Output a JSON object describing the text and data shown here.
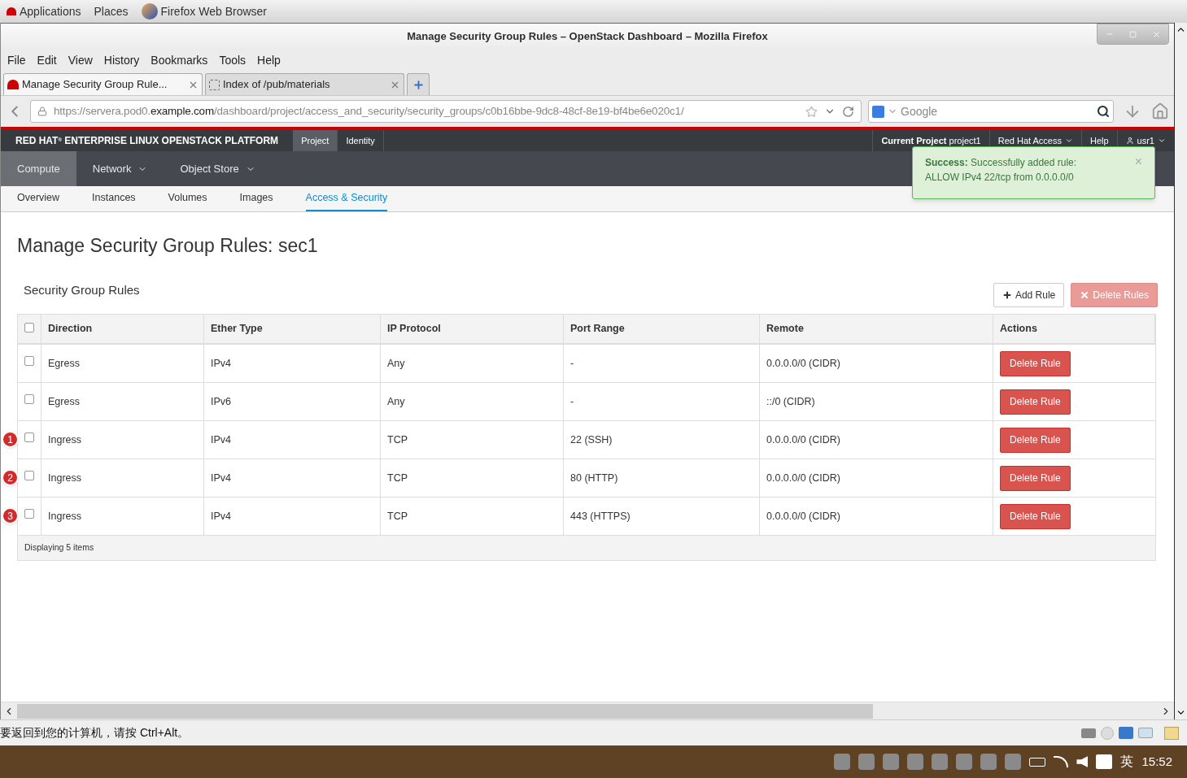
{
  "desktop_bar": {
    "items": [
      "Applications",
      "Places",
      "Firefox Web Browser"
    ]
  },
  "window": {
    "title": "Manage Security Group Rules – OpenStack Dashboard – Mozilla Firefox"
  },
  "menu": [
    "File",
    "Edit",
    "View",
    "History",
    "Bookmarks",
    "Tools",
    "Help"
  ],
  "browser_tabs": [
    {
      "label": "Manage Security Group Rule...",
      "selected": true
    },
    {
      "label": "Index of /pub/materials",
      "selected": false
    }
  ],
  "address": {
    "host_prefix": "https://servera.pod0.",
    "host": "example.com",
    "path": "/dashboard/project/access_and_security/security_groups/c0b16bbe-9dc8-48cf-8e19-bf4be6e020c1/"
  },
  "search": {
    "placeholder": "Google"
  },
  "header": {
    "brand": "RED HAT",
    "brand_sup": "®",
    "brand_rest": "ENTERPRISE LINUX OPENSTACK PLATFORM",
    "tabs": [
      {
        "label": "Project",
        "selected": true
      },
      {
        "label": "Identity",
        "selected": false
      }
    ],
    "current_project_label": "Current Project",
    "current_project": "project1",
    "links": [
      "Red Hat Access",
      "Help"
    ],
    "user": "usr1"
  },
  "nav": [
    {
      "label": "Compute",
      "selected": true,
      "dropdown": false
    },
    {
      "label": "Network",
      "selected": false,
      "dropdown": true
    },
    {
      "label": "Object Store",
      "selected": false,
      "dropdown": true
    }
  ],
  "subnav": [
    {
      "label": "Overview",
      "selected": false
    },
    {
      "label": "Instances",
      "selected": false
    },
    {
      "label": "Volumes",
      "selected": false
    },
    {
      "label": "Images",
      "selected": false
    },
    {
      "label": "Access & Security",
      "selected": true
    }
  ],
  "toast": {
    "title": "Success:",
    "message": "Successfully added rule: ALLOW IPv4 22/tcp from 0.0.0.0/0",
    "close": "×"
  },
  "page_title": "Manage Security Group Rules: sec1",
  "section_title": "Security Group Rules",
  "buttons": [
    {
      "label": "Add Rule",
      "kind": "add"
    },
    {
      "label": "Delete Rules",
      "kind": "delete"
    }
  ],
  "table": {
    "columns": [
      "Direction",
      "Ether Type",
      "IP Protocol",
      "Port Range",
      "Remote",
      "Actions"
    ],
    "header_checked": false,
    "rows": [
      {
        "marker": "",
        "checked": false,
        "cells": [
          "Egress",
          "IPv4",
          "Any",
          "-",
          "0.0.0.0/0 (CIDR)"
        ],
        "action": "Delete Rule"
      },
      {
        "marker": "",
        "checked": false,
        "cells": [
          "Egress",
          "IPv6",
          "Any",
          "-",
          "::/0 (CIDR)"
        ],
        "action": "Delete Rule"
      },
      {
        "marker": "1",
        "checked": false,
        "cells": [
          "Ingress",
          "IPv4",
          "TCP",
          "22 (SSH)",
          "0.0.0.0/0 (CIDR)"
        ],
        "action": "Delete Rule"
      },
      {
        "marker": "2",
        "checked": false,
        "cells": [
          "Ingress",
          "IPv4",
          "TCP",
          "80 (HTTP)",
          "0.0.0.0/0 (CIDR)"
        ],
        "action": "Delete Rule"
      },
      {
        "marker": "3",
        "checked": false,
        "cells": [
          "Ingress",
          "IPv4",
          "TCP",
          "443 (HTTPS)",
          "0.0.0.0/0 (CIDR)"
        ],
        "action": "Delete Rule"
      }
    ],
    "footer": "Displaying 5 items"
  },
  "vm_status": "要返回到您的计算机，请按 Ctrl+Alt。",
  "taskbar": {
    "ime": "英",
    "clock": "15:52"
  }
}
